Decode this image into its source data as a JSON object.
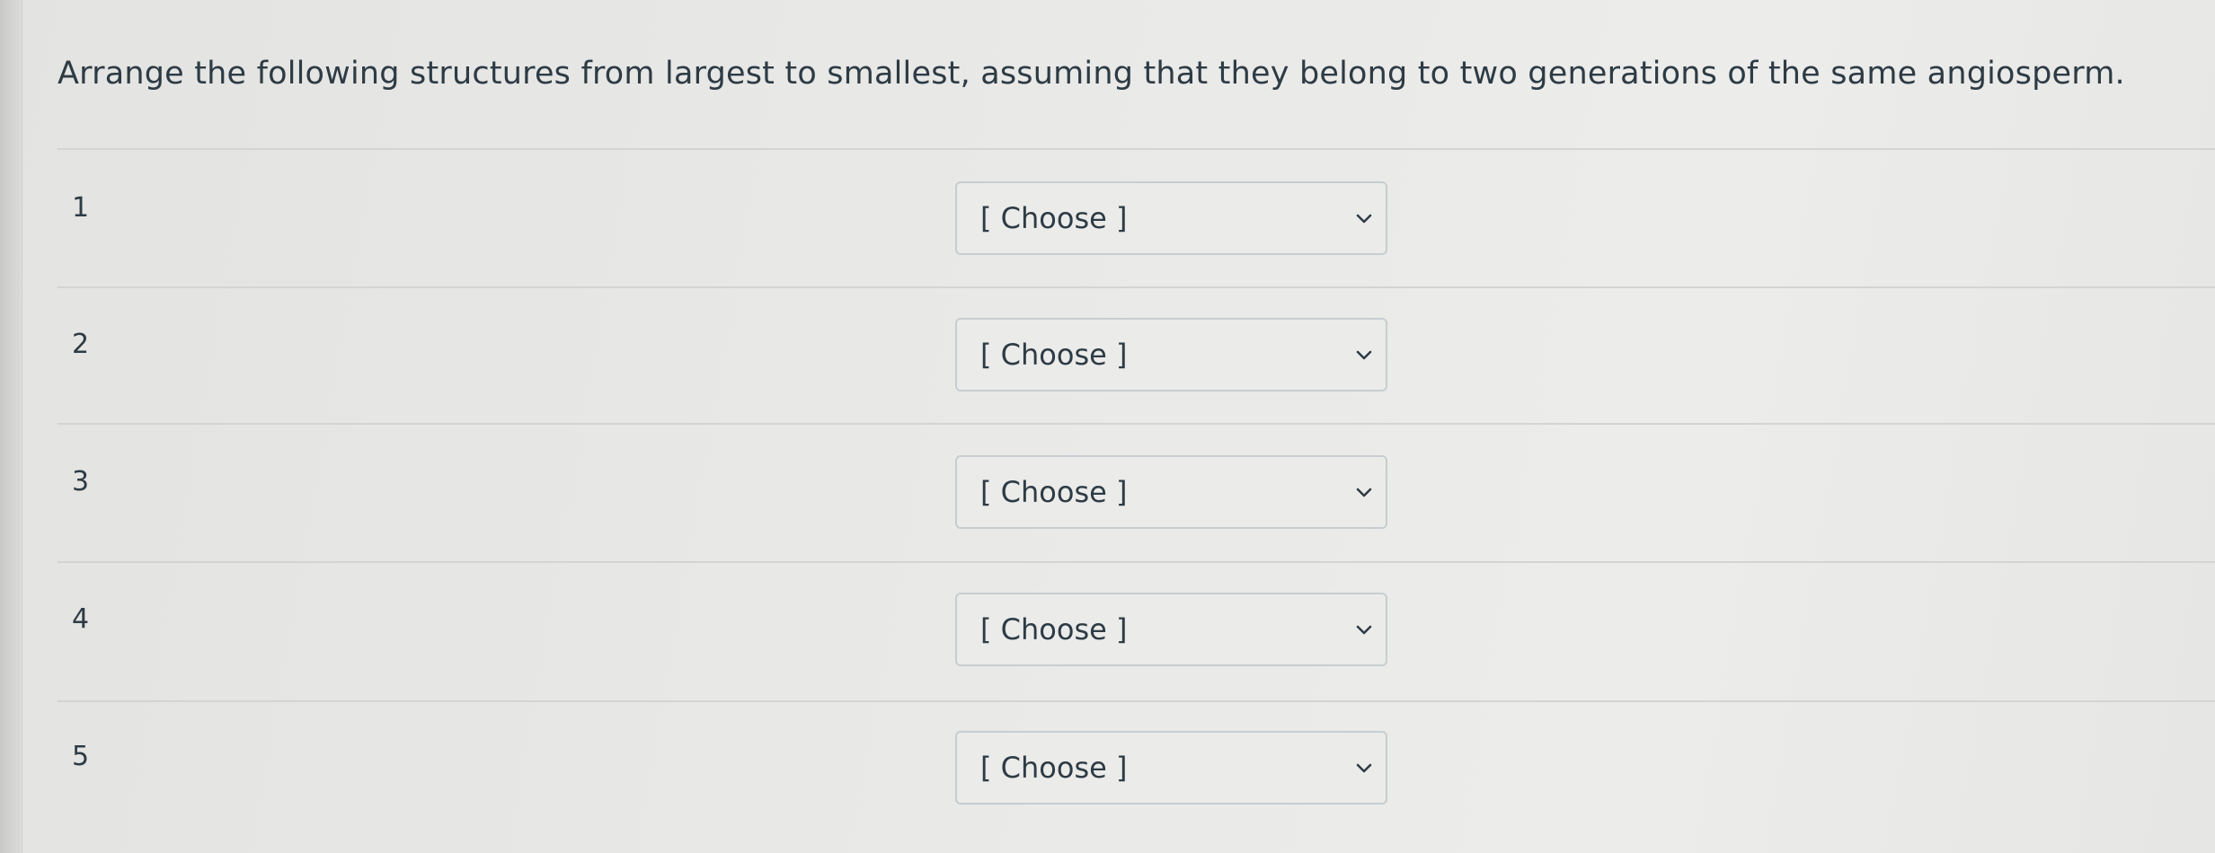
{
  "question": {
    "text": "Arrange the following structures from largest to smallest, assuming that they belong to two generations of the same angiosperm."
  },
  "rows": [
    {
      "number": "1",
      "select": {
        "value": "[ Choose ]",
        "icon": "chevron-down-icon"
      }
    },
    {
      "number": "2",
      "select": {
        "value": "[ Choose ]",
        "icon": "chevron-down-icon"
      }
    },
    {
      "number": "3",
      "select": {
        "value": "[ Choose ]",
        "icon": "chevron-down-icon"
      }
    },
    {
      "number": "4",
      "select": {
        "value": "[ Choose ]",
        "icon": "chevron-down-icon"
      }
    },
    {
      "number": "5",
      "select": {
        "value": "[ Choose ]",
        "icon": "chevron-down-icon"
      }
    }
  ],
  "colors": {
    "text": "#2d3b45",
    "divider": "#d4d4d2",
    "select_border": "#c7cdd1"
  }
}
